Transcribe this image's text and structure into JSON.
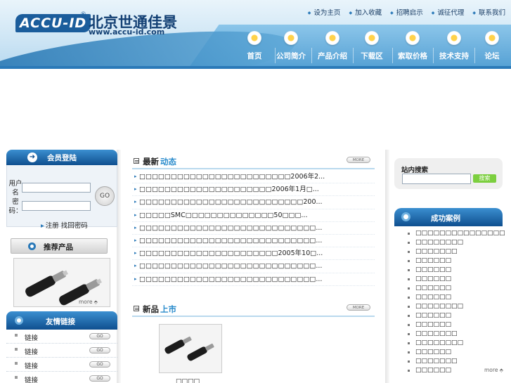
{
  "header": {
    "logo_mark": "ACCU-ID",
    "logo_reg": "®",
    "logo_cn": "北京世通佳景",
    "logo_url": "www.accu-id.com",
    "top_links": [
      "设为主页",
      "加入收藏",
      "招聘启示",
      "诚征代理",
      "联系我们"
    ],
    "nav": [
      "首页",
      "公司简介",
      "产品介绍",
      "下载区",
      "索取价格",
      "技术支持",
      "论坛"
    ]
  },
  "login": {
    "title": "会员登陆",
    "user_label": "用户名",
    "pass_label": "密码：",
    "go": "GO",
    "register": "注册  找回密码"
  },
  "products": {
    "title": "推荐产品",
    "more": "more"
  },
  "links": {
    "title": "友情链接",
    "items": [
      "链接",
      "链接",
      "链接",
      "链接"
    ],
    "go": "GO"
  },
  "news": {
    "title_a": "最新",
    "title_b": "动态",
    "more_btn": "MORE",
    "items": [
      "□□□□□□□□□□□□□□□□□□□□□□□□2006年2...",
      "□□□□□□□□□□□□□□□□□□□□□2006年1月□...",
      "□□□□□□□□□□□□□□□□□□□□□□□□□□200...",
      "□□□□□SMC□□□□□□□□□□□□□□50□□□...",
      "□□□□□□□□□□□□□□□□□□□□□□□□□□□□...",
      "□□□□□□□□□□□□□□□□□□□□□□□□□□□□...",
      "□□□□□□□□□□□□□□□□□□□□□□2005年10□...",
      "□□□□□□□□□□□□□□□□□□□□□□□□□□□□...",
      "□□□□□□□□□□□□□□□□□□□□□□□□□□□□..."
    ]
  },
  "newproducts": {
    "title_a": "新品",
    "title_b": "上市",
    "more_btn": "MORE",
    "label": "□□□□"
  },
  "search": {
    "label": "站内搜索",
    "button": "搜索"
  },
  "cases": {
    "title": "成功案例",
    "items": [
      "□□□□□□□□□□□□□□□",
      "□□□□□□□□",
      "□□□□□□□",
      "□□□□□□",
      "□□□□□□",
      "□□□□□□",
      "□□□□□□",
      "□□□□□□",
      "□□□□□□□□",
      "□□□□□□",
      "□□□□□□",
      "□□□□□□□",
      "□□□□□□□□",
      "□□□□□□",
      "□□□□□□□",
      "□□□□□□"
    ],
    "more": "more"
  },
  "colors": {
    "accent": "#2b8ccc",
    "header_dark": "#0f4f8f",
    "search_btn": "#7ccf3f"
  }
}
